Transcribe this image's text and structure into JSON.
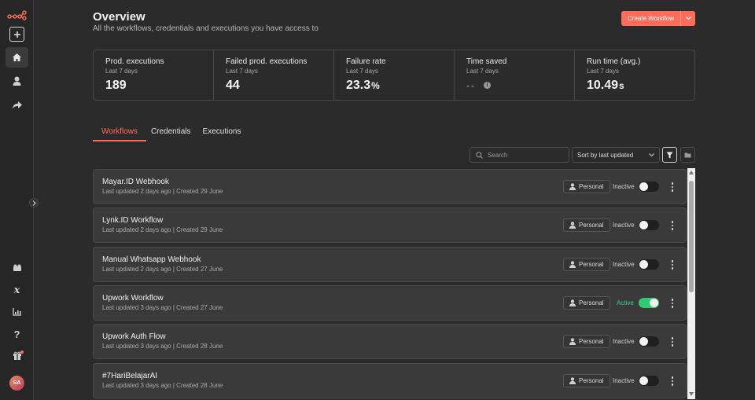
{
  "header": {
    "title": "Overview",
    "subtitle": "All the workflows, credentials and executions you have access to",
    "create_label": "Create Workflow"
  },
  "stats": [
    {
      "label": "Prod. executions",
      "period": "Last 7 days",
      "value": "189",
      "unit": ""
    },
    {
      "label": "Failed prod. executions",
      "period": "Last 7 days",
      "value": "44",
      "unit": ""
    },
    {
      "label": "Failure rate",
      "period": "Last 7 days",
      "value": "23.3",
      "unit": "%"
    },
    {
      "label": "Time saved",
      "period": "Last 7 days",
      "value": "--",
      "unit": ""
    },
    {
      "label": "Run time (avg.)",
      "period": "Last 7 days",
      "value": "10.49",
      "unit": "s"
    }
  ],
  "tabs": [
    {
      "label": "Workflows",
      "active": true
    },
    {
      "label": "Credentials",
      "active": false
    },
    {
      "label": "Executions",
      "active": false
    }
  ],
  "toolbar": {
    "search_placeholder": "Search",
    "sort_label": "Sort by last updated"
  },
  "workflows": [
    {
      "name": "Mayar.ID Webhook",
      "meta": "Last updated 2 days ago | Created 29 June",
      "owner": "Personal",
      "status": "Inactive",
      "active": false
    },
    {
      "name": "Lynk.ID Workflow",
      "meta": "Last updated 2 days ago | Created 29 June",
      "owner": "Personal",
      "status": "Inactive",
      "active": false
    },
    {
      "name": "Manual Whatsapp Webhook",
      "meta": "Last updated 2 days ago | Created 27 June",
      "owner": "Personal",
      "status": "Inactive",
      "active": false
    },
    {
      "name": "Upwork Workflow",
      "meta": "Last updated 3 days ago | Created 27 June",
      "owner": "Personal",
      "status": "Active",
      "active": true
    },
    {
      "name": "Upwork Auth Flow",
      "meta": "Last updated 3 days ago | Created 28 June",
      "owner": "Personal",
      "status": "Inactive",
      "active": false
    },
    {
      "name": "#7HariBelajarAI",
      "meta": "Last updated 3 days ago | Created 28 June",
      "owner": "Personal",
      "status": "Inactive",
      "active": false
    }
  ],
  "user": {
    "initials": "SA"
  },
  "colors": {
    "accent": "#ff6d5a",
    "active_green": "#2ecc71",
    "background": "#2b2b2b"
  }
}
